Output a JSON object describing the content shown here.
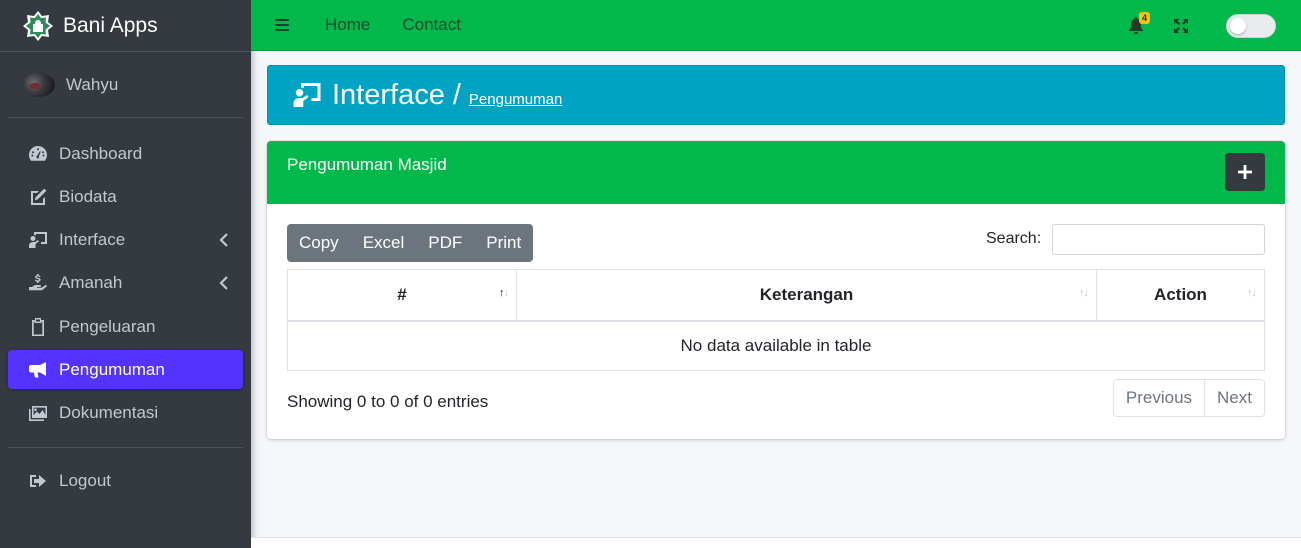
{
  "brand": {
    "name": "Bani Apps"
  },
  "user": {
    "name": "Wahyu"
  },
  "sidebar": {
    "items": [
      {
        "label": "Dashboard",
        "icon": "tachometer-icon"
      },
      {
        "label": "Biodata",
        "icon": "edit-icon"
      },
      {
        "label": "Interface",
        "icon": "chalkboard-teacher-icon",
        "has_submenu": true
      },
      {
        "label": "Amanah",
        "icon": "hand-holding-usd-icon",
        "has_submenu": true
      },
      {
        "label": "Pengeluaran",
        "icon": "clipboard-icon"
      },
      {
        "label": "Pengumuman",
        "icon": "bullhorn-icon",
        "active": true
      },
      {
        "label": "Dokumentasi",
        "icon": "images-icon"
      }
    ],
    "logout": {
      "label": "Logout",
      "icon": "sign-out-icon"
    },
    "active_color": "#5533ff"
  },
  "topbar": {
    "links": [
      "Home",
      "Contact"
    ],
    "notification_count": "4",
    "color": "#00b94a"
  },
  "content_header": {
    "title": "Interface",
    "separator": "/",
    "breadcrumb": "Pengumuman",
    "color": "#00a3c4"
  },
  "card": {
    "title": "Pengumuman Masjid",
    "buttons": [
      "Copy",
      "Excel",
      "PDF",
      "Print"
    ],
    "search_label": "Search:",
    "search_value": "",
    "columns": [
      "#",
      "Keterangan",
      "Action"
    ],
    "empty_message": "No data available in table",
    "info": "Showing 0 to 0 of 0 entries",
    "pagination": {
      "previous": "Previous",
      "next": "Next"
    }
  }
}
